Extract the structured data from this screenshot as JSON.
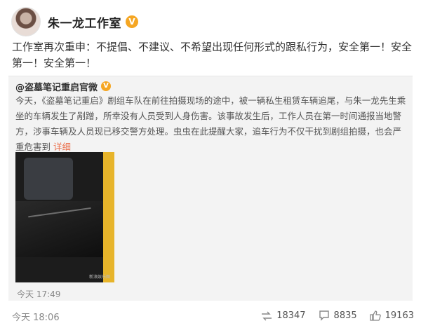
{
  "author": {
    "name": "朱一龙工作室",
    "verified_mark": "V"
  },
  "post": {
    "text": "工作室再次重申：不提倡、不建议、不希望出现任何形式的跟私行为，安全第一！安全第一！安全第一！",
    "time": "今天 18:06"
  },
  "repost": {
    "author": "@盗墓笔记重启官微",
    "verified_mark": "V",
    "text": "今天，《盗墓笔记重启》剧组车队在前往拍摄现场的途中，被一辆私生租赁车辆追尾，与朱一龙先生乘坐的车辆发生了剐蹭，所幸没有人员受到人身伤害。该事故发生后，工作人员在第一时间通报当地警方，涉事车辆及人员现已移交警方处理。虫虫在此提醒大家，追车行为不仅干扰到剧组拍摄，也会严重危害到",
    "more_label": "详细",
    "time": "今天 17:49",
    "image_watermark": "新浪娱乐图"
  },
  "stats": {
    "reposts": "18347",
    "comments": "8835",
    "likes": "19163"
  },
  "icons": {
    "repost": "repost-icon",
    "comment": "comment-icon",
    "like": "like-icon"
  },
  "colors": {
    "link": "#eb7350",
    "verified": "#f5a623"
  }
}
